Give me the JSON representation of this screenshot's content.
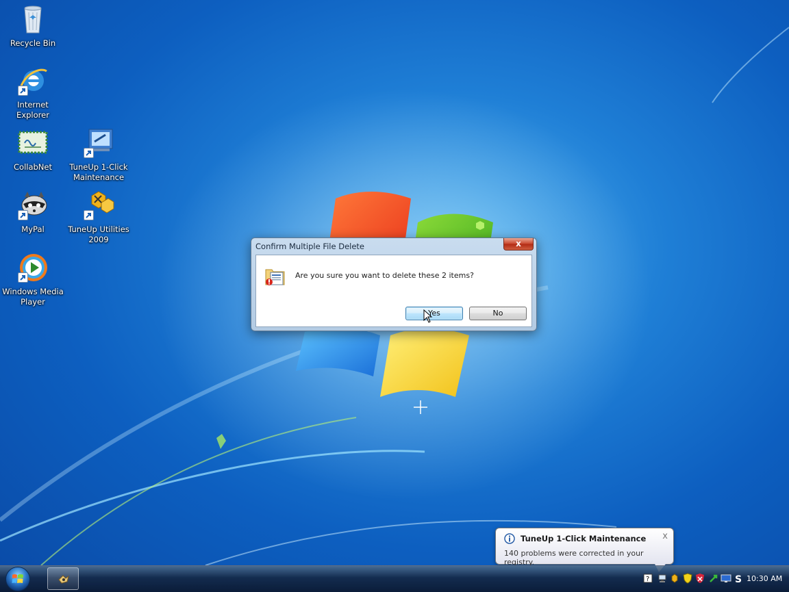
{
  "desktop": {
    "icons": [
      {
        "label": "Recycle Bin",
        "icon": "recycle-bin-icon"
      },
      {
        "label": "Internet Explorer",
        "icon": "internet-explorer-icon"
      },
      {
        "label": "CollabNet",
        "icon": "collabnet-icon"
      },
      {
        "label": "TuneUp 1-Click Maintenance",
        "icon": "tuneup-1click-icon"
      },
      {
        "label": "MyPal",
        "icon": "mypal-icon"
      },
      {
        "label": "TuneUp Utilities 2009",
        "icon": "tuneup-utilities-icon"
      },
      {
        "label": "Windows Media Player",
        "icon": "windows-media-player-icon"
      }
    ]
  },
  "dialog": {
    "title": "Confirm Multiple File Delete",
    "close_label": "x",
    "message": "Are you sure you want to delete these 2 items?",
    "yes_label": "Yes",
    "no_label": "No"
  },
  "balloon": {
    "title": "TuneUp 1-Click Maintenance",
    "text": "140 problems were corrected in your registry.",
    "close_label": "x"
  },
  "taskbar": {
    "clock": "10:30 AM",
    "tray_icons": [
      "help-icon",
      "network-icon",
      "tuneup-tray-icon",
      "security-shield-icon",
      "antivirus-icon",
      "green-arrow-icon",
      "monitor-icon",
      "dollar-icon"
    ]
  },
  "colors": {
    "desktop_blue": "#1f7fd6",
    "close_red": "#c8442b",
    "default_button": "#bee6fd"
  }
}
